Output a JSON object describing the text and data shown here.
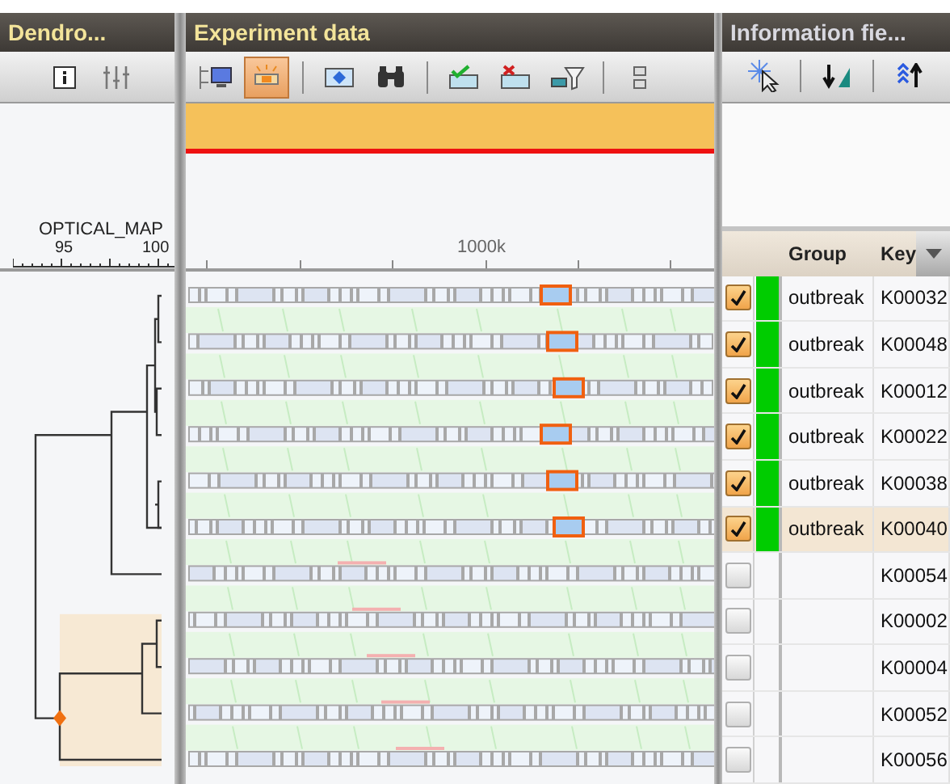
{
  "panels": {
    "dendrogram": {
      "title": "Dendro...",
      "toolbar": [
        {
          "kind": "info"
        },
        {
          "kind": "sliders"
        }
      ],
      "ruler": {
        "label": "OPTICAL_MAP",
        "ticks": [
          "95",
          "100"
        ]
      }
    },
    "experiment": {
      "title": "Experiment data",
      "toolbar": [
        {
          "kind": "tree-monitor"
        },
        {
          "kind": "highlight",
          "on": true
        },
        {
          "kind": "separator"
        },
        {
          "kind": "frame"
        },
        {
          "kind": "binoculars"
        },
        {
          "kind": "separator"
        },
        {
          "kind": "check"
        },
        {
          "kind": "cross"
        },
        {
          "kind": "filter"
        },
        {
          "kind": "separator"
        },
        {
          "kind": "split"
        }
      ],
      "ruler_label": "1000k"
    },
    "information": {
      "title": "Information fie...",
      "toolbar": [
        {
          "kind": "sparkle"
        },
        {
          "kind": "separator"
        },
        {
          "kind": "sort-down"
        },
        {
          "kind": "separator"
        },
        {
          "kind": "sort-up"
        }
      ]
    }
  },
  "table": {
    "columns": [
      "Group",
      "Key"
    ],
    "rows": [
      {
        "checked": true,
        "color": "#00cc00",
        "group": "outbreak",
        "key": "K00032",
        "selected": false
      },
      {
        "checked": true,
        "color": "#00cc00",
        "group": "outbreak",
        "key": "K00048",
        "selected": false
      },
      {
        "checked": true,
        "color": "#00cc00",
        "group": "outbreak",
        "key": "K00012",
        "selected": false
      },
      {
        "checked": true,
        "color": "#00cc00",
        "group": "outbreak",
        "key": "K00022",
        "selected": false
      },
      {
        "checked": true,
        "color": "#00cc00",
        "group": "outbreak",
        "key": "K00038",
        "selected": false
      },
      {
        "checked": true,
        "color": "#00cc00",
        "group": "outbreak",
        "key": "K00040",
        "selected": true
      },
      {
        "checked": false,
        "key": "K00054",
        "selected": false
      },
      {
        "checked": false,
        "key": "K00002",
        "selected": false
      },
      {
        "checked": false,
        "key": "K00004",
        "selected": false
      },
      {
        "checked": false,
        "key": "K00052",
        "selected": false
      },
      {
        "checked": false,
        "key": "K00056",
        "selected": false
      }
    ]
  }
}
